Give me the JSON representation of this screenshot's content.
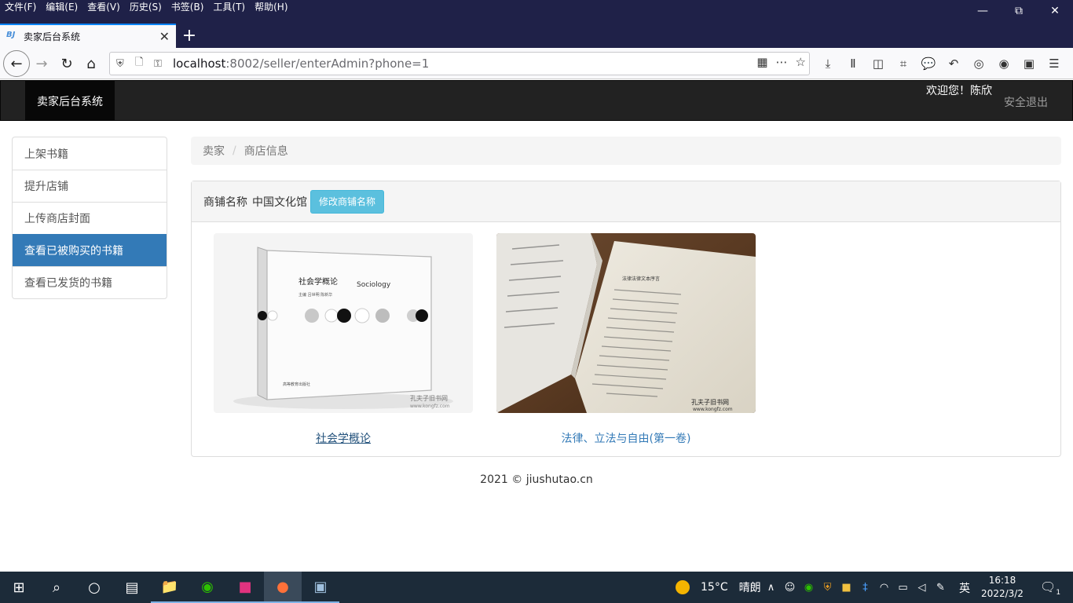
{
  "browser": {
    "menu": [
      "文件(F)",
      "编辑(E)",
      "查看(V)",
      "历史(S)",
      "书签(B)",
      "工具(T)",
      "帮助(H)"
    ],
    "tab_title": "卖家后台系统",
    "favicon_text": "BJ",
    "url_host": "localhost",
    "url_rest": ":8002/seller/enterAdmin?phone=1"
  },
  "site": {
    "brand": "卖家后台系统",
    "welcome": "欢迎您！陈欣",
    "logout": "安全退出"
  },
  "sidebar": {
    "items": [
      {
        "label": "上架书籍",
        "active": false
      },
      {
        "label": "提升店铺",
        "active": false
      },
      {
        "label": "上传商店封面",
        "active": false
      },
      {
        "label": "查看已被购买的书籍",
        "active": true
      },
      {
        "label": "查看已发货的书籍",
        "active": false
      }
    ]
  },
  "breadcrumb": {
    "items": [
      "卖家",
      "商店信息"
    ]
  },
  "shop": {
    "name_label": "商铺名称",
    "name": "中国文化馆",
    "edit_button": "修改商铺名称"
  },
  "books": [
    {
      "title": "社会学概论",
      "cover_title": "社会学概论",
      "cover_subtitle": "Sociology",
      "cover_editors": "主编  吕世明  陈新华",
      "cover_publisher": "高等教育出版社",
      "watermark": "孔夫子旧书网",
      "watermark_url": "www.kongfz.com"
    },
    {
      "title": "法律、立法与自由(第一卷)",
      "cover_header": "法律法律文本序言",
      "watermark": "孔夫子旧书网",
      "watermark_url": "www.kongfz.com"
    }
  ],
  "footer": "2021 © jiushutao.cn",
  "taskbar": {
    "temperature": "15°C",
    "weather": "晴朗",
    "ime": "英",
    "time": "16:18",
    "date": "2022/3/2",
    "notifications": "1"
  },
  "colors": {
    "navbar": "#222222",
    "active_menu": "#337ab7",
    "info_button": "#5bc0de",
    "link": "#337ab7"
  }
}
